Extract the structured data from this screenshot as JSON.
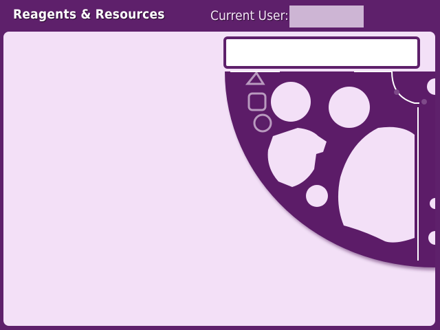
{
  "header": {
    "title": "Reagents & Resources",
    "user_label": "Current User:",
    "user_value": ""
  },
  "main": {
    "search_value": ""
  },
  "colors": {
    "frame": "#5e206b",
    "panel": "#f3e0f7",
    "wheel": "#5b1f68",
    "user_box": "#cdb5d4"
  }
}
